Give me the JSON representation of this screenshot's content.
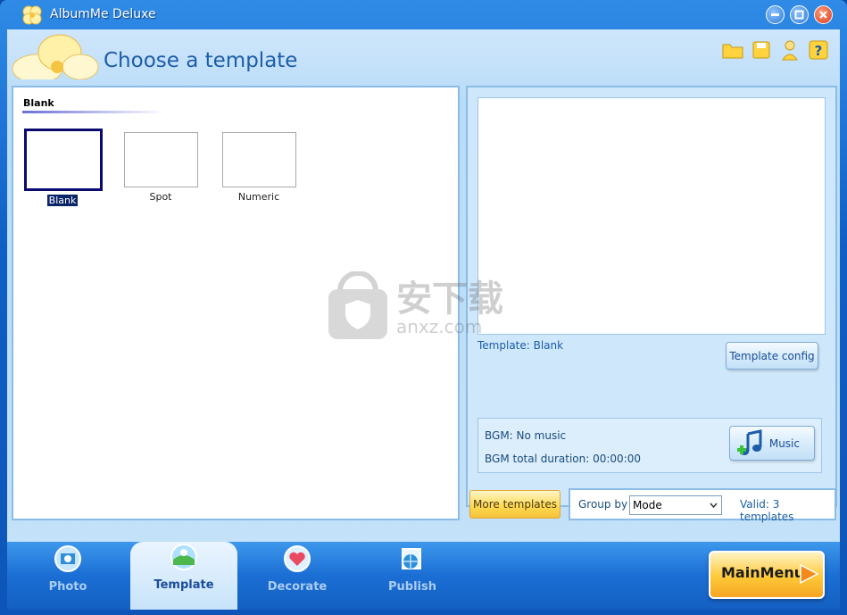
{
  "window": {
    "title": "AlbumMe Deluxe"
  },
  "header": {
    "title": "Choose a template",
    "tools": [
      "folder-icon",
      "save-icon",
      "help-person-icon",
      "help-icon"
    ]
  },
  "templates": {
    "group_label": "Blank",
    "items": [
      {
        "label": "Blank",
        "selected": true
      },
      {
        "label": "Spot",
        "selected": false
      },
      {
        "label": "Numeric",
        "selected": false
      }
    ]
  },
  "preview": {
    "template_info": "Template:  Blank",
    "config_label": "Template config",
    "bgm": "BGM: No music",
    "bgm_duration": "BGM total duration: 00:00:00",
    "music_label": "Music"
  },
  "filter": {
    "more_templates": "More templates",
    "group_by_label": "Group by",
    "group_by_value": "Mode",
    "valid": "Valid: 3 templates"
  },
  "tabs": [
    {
      "label": "Photo",
      "active": false
    },
    {
      "label": "Template",
      "active": true
    },
    {
      "label": "Decorate",
      "active": false
    },
    {
      "label": "Publish",
      "active": false
    }
  ],
  "main_menu_label": "MainMenu",
  "watermark": {
    "text": "安下载",
    "sub": "anxz.com"
  },
  "colors": {
    "accent": "#1d5da8",
    "frame": "#0f5fc6",
    "selection": "#0a246a"
  }
}
